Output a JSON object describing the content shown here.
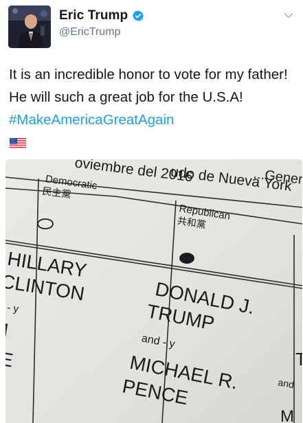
{
  "author": {
    "name": "Eric Trump",
    "handle": "@EricTrump",
    "avatar_icon": "profile-photo",
    "verified_icon": "verified-badge-icon"
  },
  "tweet": {
    "text_before": "It is an incredible honor to vote for my father! He will such a great job for the U.S.A! ",
    "hashtag": "#MakeAmericaGreatAgain",
    "emoji": "us-flag-icon"
  },
  "photo": {
    "header_line_1": "udo de Nueva York",
    "header_line_1_prefix": "...General",
    "header_line_2": "oviembre del 2016",
    "party_left": "Democratic",
    "party_left_cjk": "民主黨",
    "party_right": "Republican",
    "party_right_cjk": "共和黨",
    "cand_left_1": "HILLARY",
    "cand_left_2": "CLINTON",
    "and_left": "d - y",
    "vp_left_1": "M",
    "vp_left_2": "NE",
    "cand_right_1": "DONALD J.",
    "cand_right_2": "TRUMP",
    "and_right": "and - y",
    "vp_right_1": "MICHAEL R.",
    "vp_right_2": "PENCE",
    "edge_right_1": "T",
    "edge_right_2": "and",
    "edge_right_3": "M"
  },
  "colors": {
    "link": "#1da1f2",
    "text": "#14171a",
    "secondary": "#657786"
  }
}
